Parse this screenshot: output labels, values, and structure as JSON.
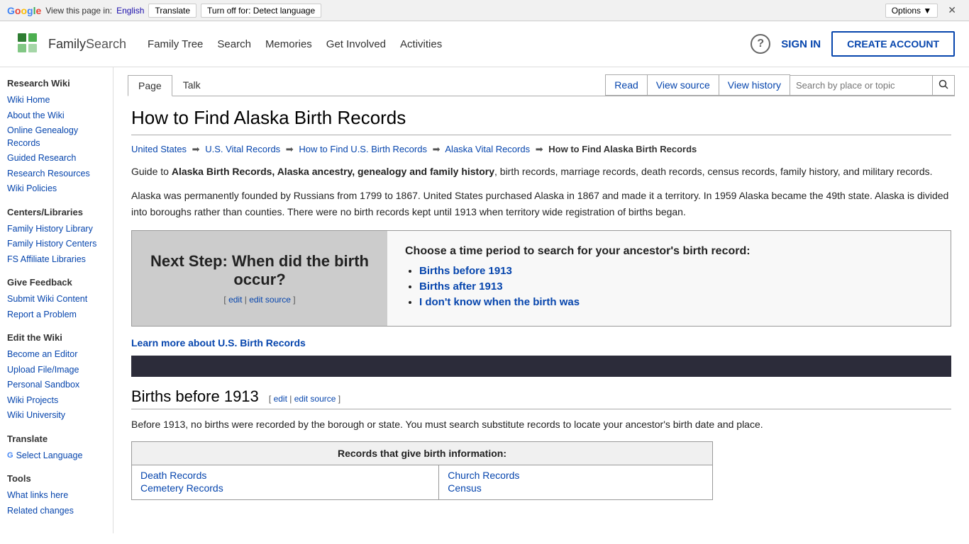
{
  "translate_bar": {
    "view_text": "View this page in:",
    "language": "English",
    "translate_btn": "Translate",
    "turnoff_btn": "Turn off for: Detect language",
    "options_btn": "Options ▼",
    "close_btn": "✕"
  },
  "header": {
    "logo_text_family": "Family",
    "logo_text_search": "Search",
    "nav_items": [
      "Family Tree",
      "Search",
      "Memories",
      "Get Involved",
      "Activities"
    ],
    "sign_in_label": "SIGN IN",
    "create_account_label": "CREATE ACCOUNT"
  },
  "sidebar": {
    "sections": [
      {
        "title": "Research Wiki",
        "links": [
          "Wiki Home",
          "About the Wiki",
          "Online Genealogy Records",
          "Guided Research",
          "Research Resources",
          "Wiki Policies"
        ]
      },
      {
        "title": "Centers/Libraries",
        "links": [
          "Family History Library",
          "Family History Centers",
          "FS Affiliate Libraries"
        ]
      },
      {
        "title": "Give Feedback",
        "links": [
          "Submit Wiki Content",
          "Report a Problem"
        ]
      },
      {
        "title": "Edit the Wiki",
        "links": [
          "Become an Editor",
          "Upload File/Image",
          "Personal Sandbox",
          "Wiki Projects",
          "Wiki University"
        ]
      },
      {
        "title": "Translate",
        "links": []
      },
      {
        "title": "Tools",
        "links": [
          "What links here",
          "Related changes"
        ]
      }
    ]
  },
  "tabs": {
    "left": [
      "Page",
      "Talk"
    ],
    "right": [
      "Read",
      "View source",
      "View history"
    ],
    "search_placeholder": "Search by place or topic"
  },
  "article": {
    "title": "How to Find Alaska Birth Records",
    "breadcrumb": [
      {
        "text": "United States",
        "href": "#"
      },
      {
        "text": "U.S. Vital Records",
        "href": "#"
      },
      {
        "text": "How to Find U.S. Birth Records",
        "href": "#"
      },
      {
        "text": "Alaska Vital Records",
        "href": "#"
      },
      {
        "text": "How to Find Alaska Birth Records",
        "current": true
      }
    ],
    "intro": "Guide to ",
    "intro_bold": "Alaska Birth Records, Alaska ancestry, genealogy and family history",
    "intro_rest": ", birth records, marriage records, death records, census records, family history, and military records.",
    "paragraph2": "Alaska was permanently founded by Russians from 1799 to 1867. United States purchased Alaska in 1867 and made it a territory. In 1959 Alaska became the 49th state. Alaska is divided into boroughs rather than counties. There were no birth records kept until 1913 when territory wide registration of births began.",
    "info_box": {
      "next_step": "Next Step: When did the birth occur?",
      "edit_label": "[ edit | edit source ]",
      "choose_title": "Choose a time period to search for your ancestor's birth record:",
      "choices": [
        "Births before 1913",
        "Births after 1913",
        "I don't know when the birth was"
      ]
    },
    "learn_more": "Learn more about U.S. Birth Records",
    "section1": {
      "heading": "Births before 1913",
      "edit_links": "[ edit | edit source ]",
      "body": "Before 1913, no births were recorded by the borough or state. You must search substitute records to locate your ancestor's birth date and place.",
      "table": {
        "header": "Records that give birth information:",
        "col1": [
          "Death Records",
          "Cemetery Records"
        ],
        "col2": [
          "Church Records",
          "Census"
        ]
      }
    }
  }
}
